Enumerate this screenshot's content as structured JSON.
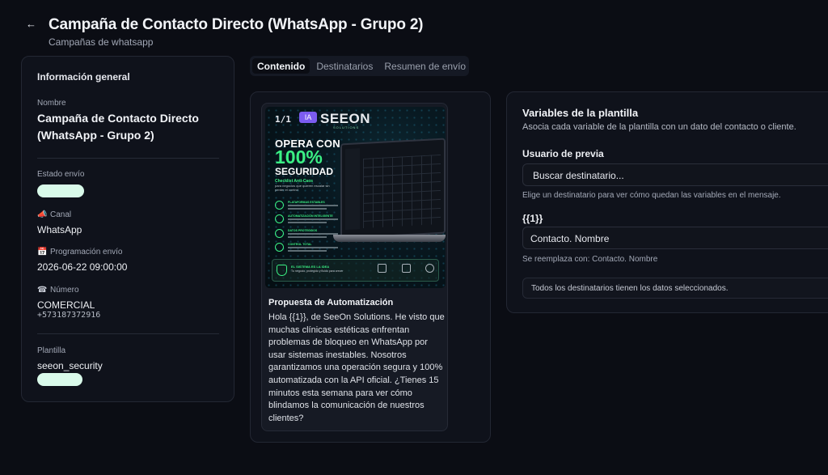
{
  "header": {
    "back_icon": "arrow-left-icon",
    "title": "Campaña de Contacto Directo (WhatsApp - Grupo 2)",
    "subtitle": "Campañas de whatsapp"
  },
  "info": {
    "section_title": "Información general",
    "name_label": "Nombre",
    "name_value": "Campaña de Contacto Directo (WhatsApp - Grupo 2)",
    "status_label": "Estado envío",
    "status_badge_color": "#d9faea",
    "channel_label": "Canal",
    "channel_value": "WhatsApp",
    "schedule_label": "Programación envío",
    "schedule_value": "2026-06-22 09:00:00",
    "number_label": "Número",
    "number_name": "COMERCIAL",
    "number_value": "+573187372916",
    "template_label": "Plantilla",
    "template_value": "seeon_security"
  },
  "tabs": [
    {
      "label": "Contenido",
      "active": true
    },
    {
      "label": "Destinatarios",
      "active": false
    },
    {
      "label": "Resumen de envío",
      "active": false
    }
  ],
  "preview": {
    "image": {
      "logo_mark": "1/1",
      "ia_badge": "IA",
      "brand": "SEEON",
      "brand_sub": "SOLUTIONS",
      "headline_1": "OPERA CON",
      "headline_pct": "100%",
      "headline_2": "SEGURIDAD",
      "checklist": "Checklist Anti-Caos",
      "checklist_sub": "para negocios que quieren escalar sin perder el control",
      "features": [
        "PLATAFORMAS ESTABLES",
        "AUTOMATIZACIÓN INTELIGENTE",
        "DATOS PROTEGIDOS",
        "CONTROL TOTAL"
      ],
      "footer_title": "EL SISTEMA ES LA IDEA",
      "footer_sub": "Tu negocio, protegido y fluido para crecer"
    },
    "title": "Propuesta de Automatización",
    "body": "Hola {{1}}, de SeeOn Solutions. He visto que muchas clínicas estéticas enfrentan problemas de bloqueo en WhatsApp por usar sistemas inestables. Nosotros garantizamos una operación segura y 100% automatizada con la API oficial. ¿Tienes 15 minutos esta semana para ver cómo blindamos la comunicación de nuestros clientes?"
  },
  "variables": {
    "title": "Variables de la plantilla",
    "subtitle": "Asocia cada variable de la plantilla con un dato del contacto o cliente.",
    "preview_user_label": "Usuario de previa",
    "search_placeholder": "Buscar destinatario...",
    "search_hint": "Elige un destinatario para ver cómo quedan las variables en el mensaje.",
    "var_label": "{{1}}",
    "var_value": "Contacto. Nombre",
    "var_hint": "Se reemplaza con: Contacto. Nombre",
    "note": "Todos los destinatarios tienen los datos seleccionados."
  },
  "colors": {
    "accent_green": "#3bf084",
    "ia_purple": "#7c5cf0",
    "background": "#0b0d14"
  }
}
